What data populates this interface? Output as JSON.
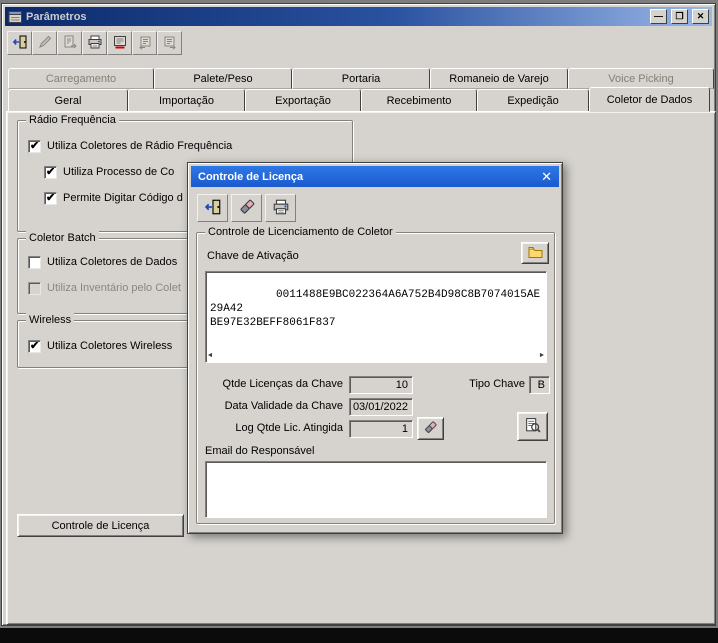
{
  "colors": {
    "window_bg": "#d6d3ce",
    "titlebar_gradient_start": "#0b2a6b",
    "titlebar_gradient_end": "#9ab8e8",
    "dialog_titlebar": "#1f63d8",
    "disabled_text": "#848078",
    "accent_red": "#d00000"
  },
  "window": {
    "title": "Parâmetros",
    "buttons": {
      "minimize": "—",
      "maximize": "❐",
      "close": "✕"
    }
  },
  "toolbar": {
    "buttons": [
      {
        "name": "exit",
        "enabled": true
      },
      {
        "name": "edit",
        "enabled": false
      },
      {
        "name": "post",
        "enabled": false
      },
      {
        "name": "print",
        "enabled": true
      },
      {
        "name": "delete",
        "enabled": true
      },
      {
        "name": "nav-first",
        "enabled": false
      },
      {
        "name": "nav-last",
        "enabled": false
      }
    ]
  },
  "tabs_row1": [
    {
      "label": "Carregamento",
      "disabled": true
    },
    {
      "label": "Palete/Peso",
      "disabled": false
    },
    {
      "label": "Portaria",
      "disabled": false
    },
    {
      "label": "Romaneio de Varejo",
      "disabled": false
    },
    {
      "label": "Voice Picking",
      "disabled": true
    }
  ],
  "tabs_row2": [
    {
      "label": "Geral",
      "selected": false
    },
    {
      "label": "Importação",
      "selected": false
    },
    {
      "label": "Exportação",
      "selected": false
    },
    {
      "label": "Recebimento",
      "selected": false
    },
    {
      "label": "Expedição",
      "selected": false
    },
    {
      "label": "Coletor de Dados",
      "selected": true
    }
  ],
  "coletor_tab": {
    "radio_group": {
      "title": "Rádio Frequência",
      "items": [
        {
          "label": "Utiliza Coletores de Rádio Frequência",
          "checked": true,
          "disabled": false
        },
        {
          "label": "Utiliza Processo de Co",
          "checked": true,
          "disabled": false
        },
        {
          "label": "Permite Digitar Código d",
          "checked": true,
          "disabled": false
        }
      ]
    },
    "batch_group": {
      "title": "Coletor Batch",
      "items": [
        {
          "label": "Utiliza Coletores de Dados",
          "checked": false,
          "disabled": false
        },
        {
          "label": "Utiliza Inventário pelo Colet",
          "checked": false,
          "disabled": true
        }
      ]
    },
    "wireless_group": {
      "title": "Wireless",
      "items": [
        {
          "label": "Utiliza Coletores Wireless",
          "checked": true,
          "disabled": false
        }
      ]
    },
    "license_button_label": "Controle de Licença"
  },
  "dialog": {
    "title": "Controle de Licença",
    "close": "✕",
    "group_title": "Controle de Licenciamento de Coletor",
    "key_label": "Chave de Ativação",
    "key_value": "0011488E9BC022364A6A752B4D98C8B7074015AE29A42\nBE97E32BEFF8061F837",
    "qtde_label": "Qtde Licenças da Chave",
    "qtde_value": "10",
    "tipo_label": "Tipo Chave",
    "tipo_value": "B",
    "data_label": "Data Validade da Chave",
    "data_value": "03/01/2022",
    "log_label": "Log Qtde Lic. Atingida",
    "log_value": "1",
    "email_label": "Email do Responsável",
    "email_value": ""
  }
}
